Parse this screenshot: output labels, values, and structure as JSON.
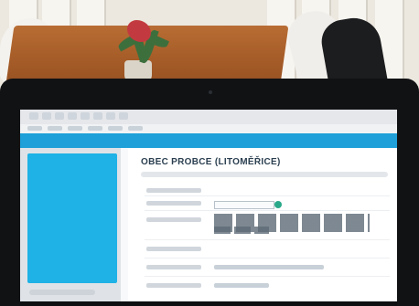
{
  "photo": {
    "laptop_screen": {
      "heading": "OBEC PROBCE (LITOMĚŘICE)"
    }
  }
}
